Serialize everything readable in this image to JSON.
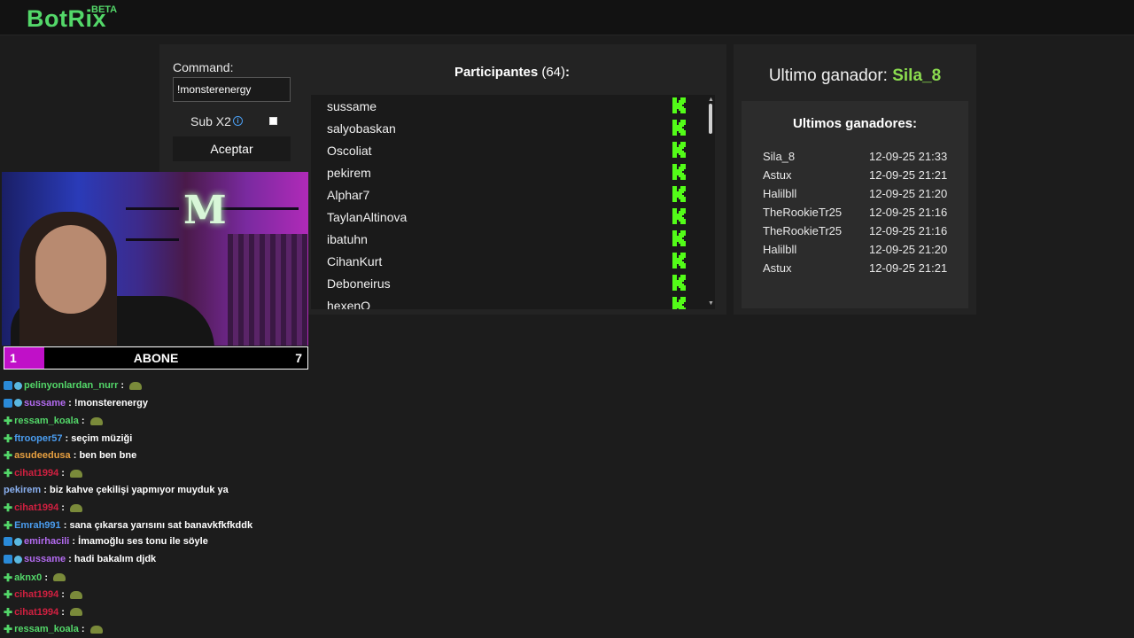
{
  "brand": {
    "logo": "BotRix",
    "tag": "BETA",
    "accent": "#53d769"
  },
  "command": {
    "label": "Command:",
    "value": "!monsterenergy",
    "sub_label": "Sub X2",
    "sub_checked": false,
    "accept_label": "Aceptar"
  },
  "participants": {
    "title": "Participantes",
    "count": "(64)",
    "suffix": ":",
    "items": [
      "sussame",
      "salyobaskan",
      "Oscoliat",
      "pekirem",
      "Alphar7",
      "TaylanAltinova",
      "ibatuhn",
      "CihanKurt",
      "Deboneirus",
      "hexenO"
    ],
    "platform_icon": "kick-icon"
  },
  "last_winner": {
    "label": "Ultimo ganador: ",
    "name": "Sila_8"
  },
  "winners": {
    "title": "Ultimos ganadores:",
    "rows": [
      {
        "name": "Sila_8",
        "date": "12-09-25 21:33"
      },
      {
        "name": "Astux",
        "date": "12-09-25 21:21"
      },
      {
        "name": "Halilbll",
        "date": "12-09-25 21:20"
      },
      {
        "name": "TheRookieTr25",
        "date": "12-09-25 21:16"
      },
      {
        "name": "TheRookieTr25",
        "date": "12-09-25 21:16"
      },
      {
        "name": "Halilbll",
        "date": "12-09-25 21:20"
      },
      {
        "name": "Astux",
        "date": "12-09-25 21:21"
      }
    ]
  },
  "sub_goal": {
    "current": "1",
    "label": "ABONE",
    "goal": "7",
    "progress_fraction": 0.14
  },
  "chat": [
    {
      "user": "pelinyonlardan_nurr",
      "color": "#53d769",
      "badges": [
        "blue",
        "cyan"
      ],
      "text": "",
      "emote": true
    },
    {
      "user": "sussame",
      "color": "#b36bf0",
      "badges": [
        "blue",
        "cyan"
      ],
      "text": "!monsterenergy",
      "emote": false
    },
    {
      "user": "ressam_koala",
      "color": "#53d769",
      "badges": [
        "plus"
      ],
      "text": "",
      "emote": true
    },
    {
      "user": "ftrooper57",
      "color": "#4a9df0",
      "badges": [
        "plus"
      ],
      "text": "seçim müziği",
      "emote": false
    },
    {
      "user": "asudeedusa",
      "color": "#e8a040",
      "badges": [
        "plus"
      ],
      "text": "ben ben bne",
      "emote": false
    },
    {
      "user": "cihat1994",
      "color": "#d02040",
      "badges": [
        "plus"
      ],
      "text": "",
      "emote": true
    },
    {
      "user": "pekirem",
      "color": "#8ab0f0",
      "badges": [],
      "text": "biz kahve çekilişi yapmıyor muyduk ya",
      "emote": false
    },
    {
      "user": "cihat1994",
      "color": "#d02040",
      "badges": [
        "plus"
      ],
      "text": "",
      "emote": true
    },
    {
      "user": "Emrah991",
      "color": "#4a9df0",
      "badges": [
        "plus"
      ],
      "text": "sana çıkarsa yarısını sat banavkfkfkddk",
      "emote": false
    },
    {
      "user": "emirhacili",
      "color": "#b36bf0",
      "badges": [
        "blue",
        "cyan"
      ],
      "text": "İmamoğlu ses tonu ile söyle",
      "emote": false
    },
    {
      "user": "sussame",
      "color": "#b36bf0",
      "badges": [
        "blue",
        "cyan"
      ],
      "text": "hadi bakalım djdk",
      "emote": false
    },
    {
      "user": "aknx0",
      "color": "#53d769",
      "badges": [
        "plus"
      ],
      "text": "",
      "emote": true
    },
    {
      "user": "cihat1994",
      "color": "#d02040",
      "badges": [
        "plus"
      ],
      "text": "",
      "emote": true
    },
    {
      "user": "cihat1994",
      "color": "#d02040",
      "badges": [
        "plus"
      ],
      "text": "",
      "emote": true
    },
    {
      "user": "ressam_koala",
      "color": "#53d769",
      "badges": [
        "plus"
      ],
      "text": "",
      "emote": true
    }
  ]
}
